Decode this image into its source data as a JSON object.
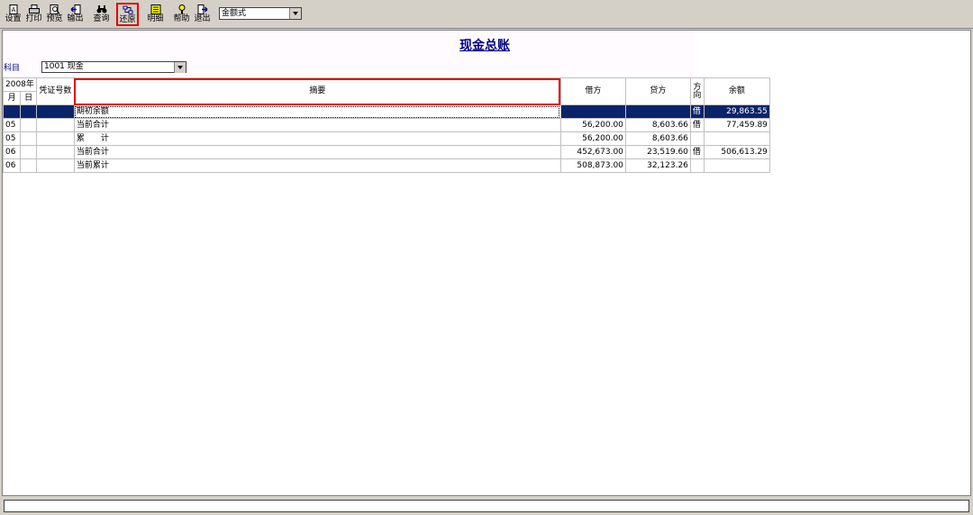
{
  "toolbar": {
    "buttons": [
      {
        "label": "设置",
        "icon": "settings-icon"
      },
      {
        "label": "打印",
        "icon": "print-icon"
      },
      {
        "label": "预览",
        "icon": "preview-icon"
      },
      {
        "label": "输出",
        "icon": "export-icon"
      },
      {
        "label": "查询",
        "icon": "search-binoculars-icon"
      },
      {
        "label": "还原",
        "icon": "restore-icon",
        "active": true
      },
      {
        "label": "明细",
        "icon": "detail-icon"
      },
      {
        "label": "帮助",
        "icon": "help-icon"
      },
      {
        "label": "退出",
        "icon": "exit-icon"
      }
    ],
    "format_select": "金额式"
  },
  "report": {
    "title": "现金总账",
    "subject_label": "科目",
    "subject_value": "1001 现金"
  },
  "ledger": {
    "headers": {
      "year": "2008年",
      "month": "月",
      "day": "日",
      "voucher": "凭证号数",
      "summary": "摘要",
      "debit": "借方",
      "credit": "贷方",
      "direction": "方向",
      "balance": "余额"
    },
    "rows": [
      {
        "month": "",
        "day": "",
        "voucher": "",
        "summary": "期初余额",
        "debit": "",
        "credit": "",
        "direction": "借",
        "balance": "29,863.55",
        "selected": true
      },
      {
        "month": "05",
        "day": "",
        "voucher": "",
        "summary": "当前合计",
        "debit": "56,200.00",
        "credit": "8,603.66",
        "direction": "借",
        "balance": "77,459.89"
      },
      {
        "month": "05",
        "day": "",
        "voucher": "",
        "summary": "累　　计",
        "debit": "56,200.00",
        "credit": "8,603.66",
        "direction": "",
        "balance": ""
      },
      {
        "month": "06",
        "day": "",
        "voucher": "",
        "summary": "当前合计",
        "debit": "452,673.00",
        "credit": "23,519.60",
        "direction": "借",
        "balance": "506,613.29"
      },
      {
        "month": "06",
        "day": "",
        "voucher": "",
        "summary": "当前累计",
        "debit": "508,873.00",
        "credit": "32,123.26",
        "direction": "",
        "balance": ""
      }
    ]
  },
  "colors": {
    "title": "#000080",
    "selection": "#0a246a",
    "highlight": "#e00000"
  }
}
